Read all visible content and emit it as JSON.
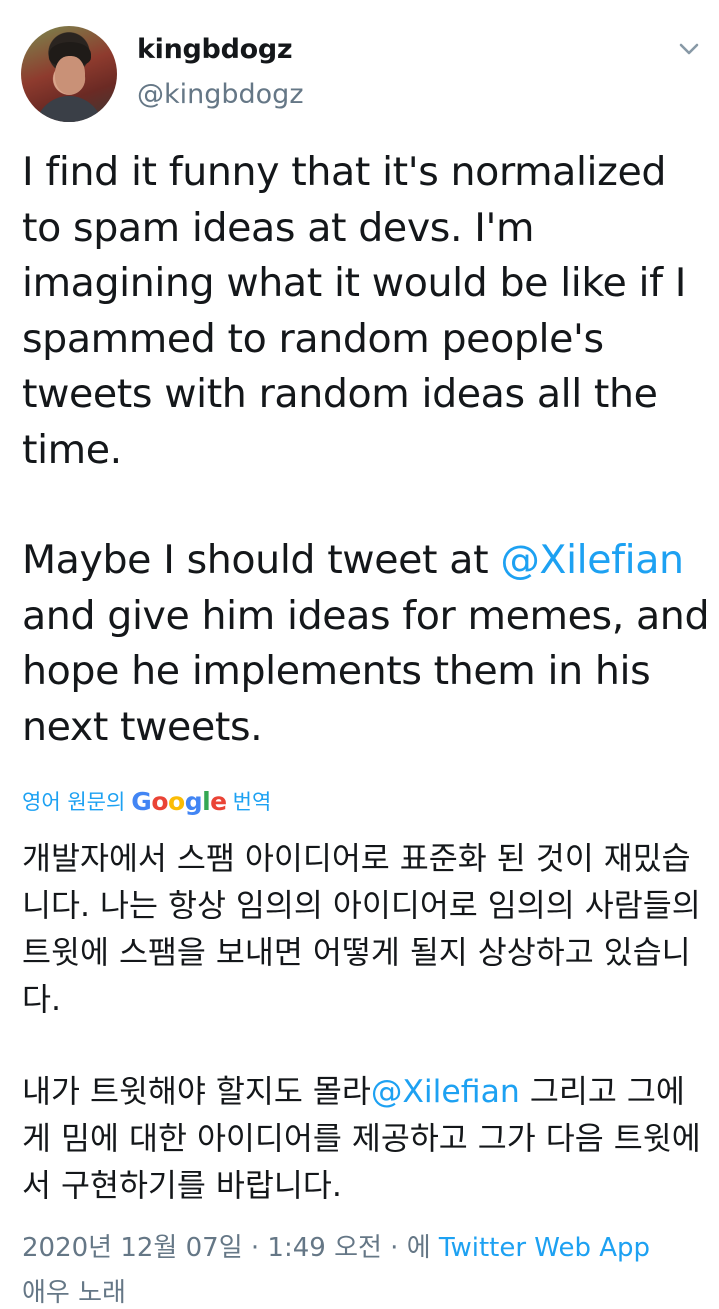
{
  "author": {
    "display_name": "kingbdogz",
    "handle": "@kingbdogz"
  },
  "tweet": {
    "paragraph1": "I find it funny that it's normalized to spam ideas at devs. I'm imagining what it would be like if I spammed to random people's tweets with random ideas all the time.",
    "paragraph2_before": "Maybe I should tweet at ",
    "paragraph2_mention": "@Xilefian",
    "paragraph2_after": " and give him ideas for memes, and hope he implements them in his next tweets."
  },
  "translation": {
    "label_before": "영어 원문의",
    "google_letters": [
      "G",
      "o",
      "o",
      "g",
      "l",
      "e"
    ],
    "label_after": "번역",
    "paragraph1": "개발자에서 스팸 아이디어로 표준화 된 것이 재밌습니다. 나는 항상 임의의 아이디어로 임의의 사람들의 트윗에 스팸을 보내면 어떻게 될지 상상하고 있습니다.",
    "paragraph2_before": " 내가 트윗해야 할지도 몰라",
    "paragraph2_mention": "@Xilefian",
    "paragraph2_after": " 그리고 그에게 밈에 대한 아이디어를 제공하고 그가 다음 트윗에서 구현하기를 바랍니다."
  },
  "meta": {
    "timestamp": "2020년 12월 07일 · 1:49 오전 · 에 ",
    "source": "Twitter Web App",
    "cut_off_text": "애우 노래"
  },
  "icons": {
    "menu": "chevron-down-icon"
  },
  "colors": {
    "link": "#1da1f2",
    "secondary_text": "#657786",
    "primary_text": "#14171a"
  }
}
